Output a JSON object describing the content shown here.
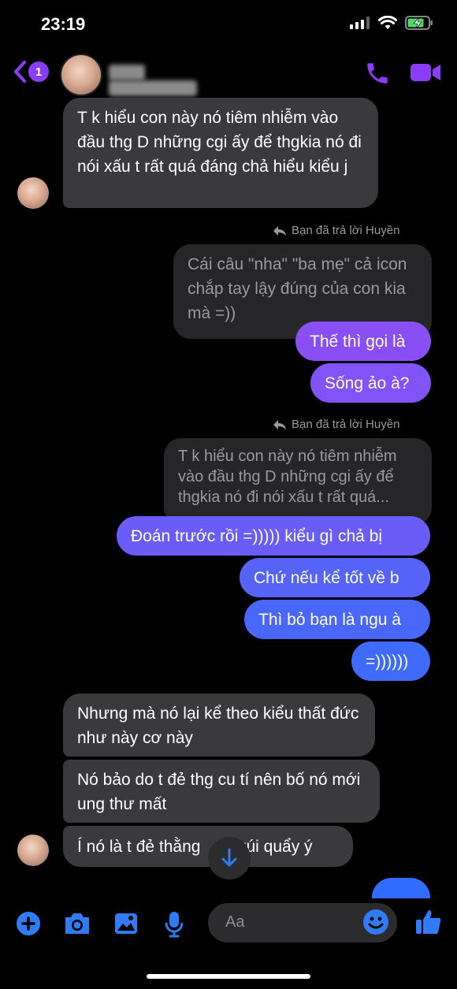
{
  "status_bar": {
    "time": "23:19"
  },
  "header": {
    "unread_count": "1"
  },
  "messages": [
    {
      "text": "T k hiểu con này nó tiêm nhiễm vào đầu thg D những cgi ấy để thgkia nó đi nói xấu t rất quá đáng chả hiểu kiểu j"
    },
    {
      "reply_note": "Bạn đã trả lời Huyền"
    },
    {
      "text": "Cái câu \"nha\" \"ba mẹ\" cả icon chắp tay lậy đúng của con kia mà =))"
    },
    {
      "text": "Thế thì gọi là"
    },
    {
      "text": "Sống ảo à?"
    },
    {
      "reply_note": "Bạn đã trả lời Huyền"
    },
    {
      "text": "T k hiểu con này nó tiêm nhiễm vào đầu thg D những cgi ấy để thgkia nó đi nói xấu t rất quá..."
    },
    {
      "text": "Đoán trước rồi =))))) kiểu gì chả bị"
    },
    {
      "text": "Chứ nếu kể tốt về b"
    },
    {
      "text": "Thì bỏ bạn là ngu à"
    },
    {
      "text": "=))))))"
    },
    {
      "text": "Nhưng mà nó lại kể theo kiểu thất đức như này cơ này"
    },
    {
      "text": "Nó bảo do t đẻ thg cu tí nên bố nó mới ung thư mất"
    },
    {
      "text_left": "Í nó là t đẻ thằng",
      "text_right": "n xúi quẩy ý"
    }
  ],
  "composer": {
    "placeholder": "Aa"
  },
  "colors": {
    "accent": "#8b3cf7",
    "received_bubble": "#3a3a3c",
    "quoted_bubble": "#262628",
    "sent_gradient_top": "#8f4cf5",
    "sent_gradient_bottom": "#3a6bff",
    "composer_icon": "#2f7cf6"
  }
}
